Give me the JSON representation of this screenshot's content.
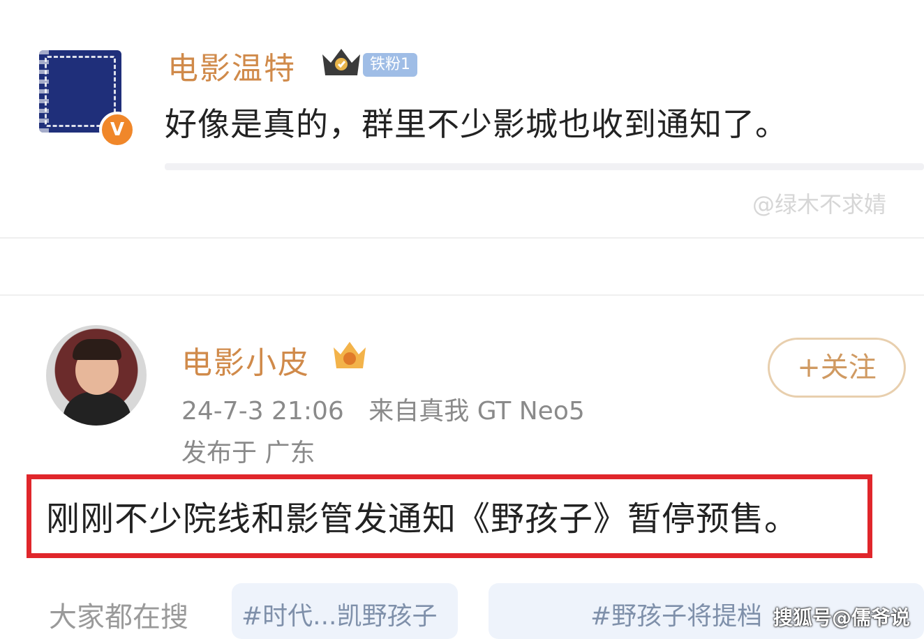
{
  "comment": {
    "author": "电影温特",
    "fan_badge": "铁粉1",
    "text": "好像是真的，群里不少影城也收到通知了。",
    "watermark": "@绿木不求婧",
    "verified_mark": "V"
  },
  "post": {
    "author": "电影小皮",
    "follow_label": "+关注",
    "time": "24-7-3 21:06",
    "source": "来自真我 GT Neo5",
    "location": "发布于 广东",
    "text": "刚刚不少院线和影管发通知《野孩子》暂停预售。"
  },
  "search": {
    "label": "大家都在搜",
    "chips": [
      "#时代...凯野孩子",
      "#野孩子将提档"
    ]
  },
  "watermark": "搜狐号@儒爷说",
  "colors": {
    "name": "#d08a4a",
    "highlight_border": "#e0262b",
    "chip_bg": "#eef3fb"
  }
}
